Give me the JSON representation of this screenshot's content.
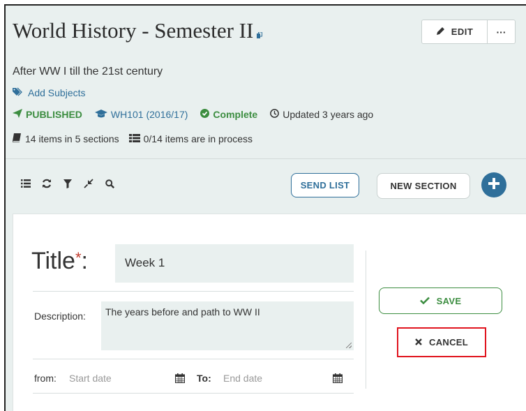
{
  "header": {
    "title": "World History - Semester II",
    "edit_label": "EDIT",
    "more_label": "···",
    "subtitle": "After WW I till the 21st century",
    "add_subjects": "Add Subjects"
  },
  "status": {
    "published": "PUBLISHED",
    "course": "WH101 (2016/17)",
    "complete": "Complete",
    "updated": "Updated 3 years ago",
    "items": "14 items in 5 sections",
    "process": "0/14 items are in process"
  },
  "toolbar": {
    "icons": [
      "list-icon",
      "refresh-icon",
      "filter-icon",
      "collapse-icon",
      "search-icon"
    ],
    "send_list": "SEND LIST",
    "new_section": "NEW SECTION"
  },
  "form": {
    "title_label": "Title",
    "required_mark": "*",
    "title_colon": ":",
    "title_value": "Week 1",
    "description_label": "Description:",
    "description_value": "The years before and path to WW II",
    "from_label": "from:",
    "from_placeholder": "Start date",
    "to_label": "To:",
    "to_placeholder": "End date",
    "save_label": "SAVE",
    "cancel_label": "CANCEL"
  },
  "colors": {
    "accent_blue": "#2f6f9a",
    "success_green": "#3c8d40",
    "highlight_red": "#e0141e",
    "panel_bg": "#e9f0ef"
  }
}
